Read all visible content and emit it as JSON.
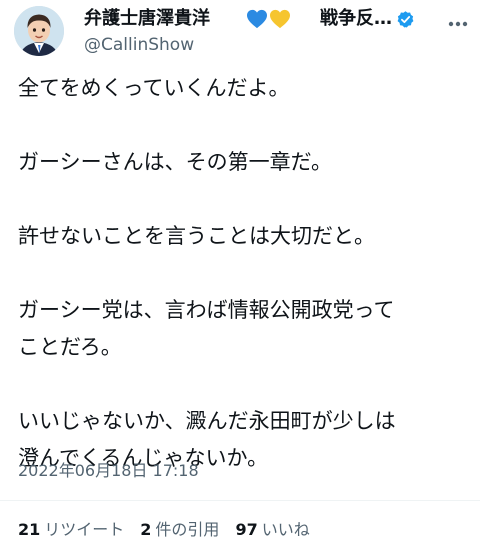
{
  "author": {
    "display_name": "弁護士唐澤貴洋",
    "hearts": [
      "blue-heart",
      "yellow-heart"
    ],
    "name_suffix": "戦争反…",
    "verified": true,
    "handle": "@CallinShow"
  },
  "tweet": {
    "lines": [
      "全てをめくっていくんだよ。",
      "",
      "ガーシーさんは、その第一章だ。",
      "",
      "許せないことを言うことは大切だと。",
      "",
      "ガーシー党は、言わば情報公開政党って",
      "ことだろ。",
      "",
      "いいじゃないか、澱んだ永田町が少しは",
      "澄んでくるんじゃないか。"
    ],
    "timestamp": "2022年06月18日 17:18"
  },
  "stats": {
    "retweets": {
      "count": "21",
      "label": "リツイート"
    },
    "quotes": {
      "count": "2",
      "label": "件の引用"
    },
    "likes": {
      "count": "97",
      "label": "いいね"
    }
  },
  "colors": {
    "text": "#0f1419",
    "secondary": "#536471",
    "verified_blue": "#1d9bf0",
    "heart_blue": "#2b8ae2",
    "heart_yellow": "#f6c52f"
  }
}
